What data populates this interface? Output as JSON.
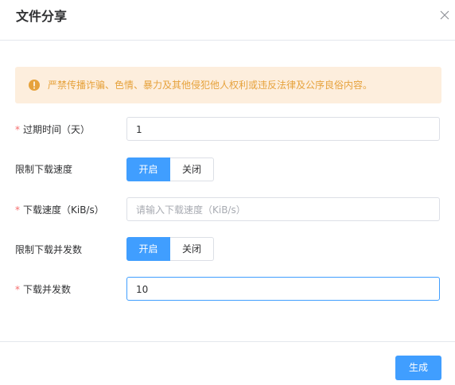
{
  "dialog": {
    "title": "文件分享",
    "close_icon": "close-icon"
  },
  "alert": {
    "icon": "warning-circle-icon",
    "text": "严禁传播诈骗、色情、暴力及其他侵犯他人权利或违反法律及公序良俗内容。",
    "color": "#e6a23c",
    "background": "#fdeedd"
  },
  "form": {
    "required_mark": "*",
    "expire": {
      "label": "过期时间（天）",
      "value": "1"
    },
    "limit_speed": {
      "label": "限制下载速度",
      "on_label": "开启",
      "off_label": "关闭",
      "selected": "开启"
    },
    "speed": {
      "label": "下载速度（KiB/s）",
      "value": "",
      "placeholder": "请输入下载速度（KiB/s）"
    },
    "limit_concurrency": {
      "label": "限制下载并发数",
      "on_label": "开启",
      "off_label": "关闭",
      "selected": "开启"
    },
    "concurrency": {
      "label": "下载并发数",
      "value": "10"
    }
  },
  "footer": {
    "generate_label": "生成"
  },
  "colors": {
    "primary": "#409eff",
    "required": "#f56c6c"
  }
}
